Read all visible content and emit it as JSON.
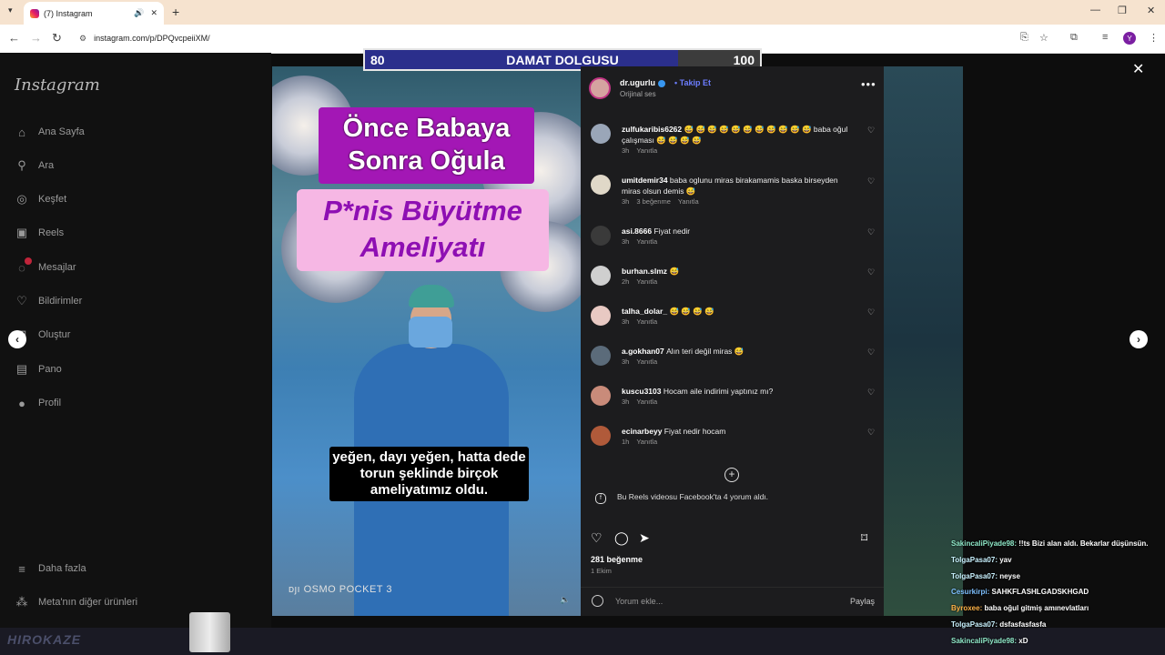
{
  "browser": {
    "tab_title": "(7) Instagram",
    "url": "instagram.com/p/DPQvcpeiiXM/",
    "profile_initial": "Y"
  },
  "sidebar": {
    "logo": "Instagram",
    "items": [
      {
        "label": "Ana Sayfa",
        "icon": "home-icon"
      },
      {
        "label": "Ara",
        "icon": "search-icon"
      },
      {
        "label": "Keşfet",
        "icon": "compass-icon"
      },
      {
        "label": "Reels",
        "icon": "reels-icon"
      },
      {
        "label": "Mesajlar",
        "icon": "messenger-icon"
      },
      {
        "label": "Bildirimler",
        "icon": "heart-icon"
      },
      {
        "label": "Oluştur",
        "icon": "plus-square-icon"
      },
      {
        "label": "Pano",
        "icon": "dashboard-icon"
      },
      {
        "label": "Profil",
        "icon": "profile-icon"
      }
    ],
    "more_label": "Daha fazla",
    "meta_label": "Meta'nın diğer ürünleri"
  },
  "stream_overlay": {
    "left_value": "80",
    "center_text": "DAMAT DOLGUSU",
    "right_value": "100"
  },
  "video": {
    "title_line1": "Önce Babaya",
    "title_line2": "Sonra Oğula",
    "title_line3": "P*nis Büyütme",
    "title_line4": "Ameliyatı",
    "subtitle": "yeğen, dayı yeğen, hatta dede torun şeklinde birçok ameliyatımız oldu.",
    "watermark": "OSMO POCKET 3"
  },
  "post": {
    "author": "dr.ugurlu",
    "follow_label": "Takip Et",
    "audio_label": "Orijinal ses",
    "comments": [
      {
        "user": "zulfukaribis6262",
        "text": "😅 😅 😅 😅 😅 😅 😅 😅 😅 😅 😅 baba oğul çalışması 😅 😅 😅 😅",
        "time": "3h",
        "likes": "",
        "reply": "Yanıtla"
      },
      {
        "user": "umitdemir34",
        "text": "baba oglunu miras birakamamis baska birseyden miras olsun demis 😅",
        "time": "3h",
        "likes": "3 beğenme",
        "reply": "Yanıtla"
      },
      {
        "user": "asi.8666",
        "text": "Fiyat nedir",
        "time": "3h",
        "likes": "",
        "reply": "Yanıtla"
      },
      {
        "user": "burhan.slmz",
        "text": "😅",
        "time": "2h",
        "likes": "",
        "reply": "Yanıtla"
      },
      {
        "user": "talha_dolar_",
        "text": "😅 😅 😅 😅",
        "time": "3h",
        "likes": "",
        "reply": "Yanıtla"
      },
      {
        "user": "a.gokhan07",
        "text": "Alın teri değil miras 😅",
        "time": "3h",
        "likes": "",
        "reply": "Yanıtla"
      },
      {
        "user": "kuscu3103",
        "text": "Hocam aile indirimi yaptınız mı?",
        "time": "3h",
        "likes": "",
        "reply": "Yanıtla"
      },
      {
        "user": "ecinarbeyy",
        "text": "Fiyat nedir hocam",
        "time": "1h",
        "likes": "",
        "reply": "Yanıtla"
      }
    ],
    "facebook_note": "Bu Reels videosu Facebook'ta 4 yorum aldı.",
    "likes_count": "281 beğenme",
    "date": "1 Ekim",
    "comment_placeholder": "Yorum ekle...",
    "share_label": "Paylaş"
  },
  "chat": [
    {
      "user": "SakincaliPiyade98",
      "msg": "!!ts Bizi alan aldı. Bekarlar düşünsün.",
      "cls": "u1"
    },
    {
      "user": "TolgaPasa07",
      "msg": "yav",
      "cls": "u2"
    },
    {
      "user": "TolgaPasa07",
      "msg": "neyse",
      "cls": "u2"
    },
    {
      "user": "Cesurkirpi",
      "msg": "SAHKFLASHLGADSKHGAD",
      "cls": "u3"
    },
    {
      "user": "Byroxee",
      "msg": "baba oğul gitmiş amınevlatları",
      "cls": "u4"
    },
    {
      "user": "TolgaPasa07",
      "msg": "dsfasfasfasfa",
      "cls": "u2"
    },
    {
      "user": "SakincaliPiyade98",
      "msg": "xD",
      "cls": "u1"
    }
  ],
  "colors": {
    "accent_blue": "#6c7dff",
    "overlay_bar": "#2b2f8c",
    "title_purple": "#a317b5"
  }
}
